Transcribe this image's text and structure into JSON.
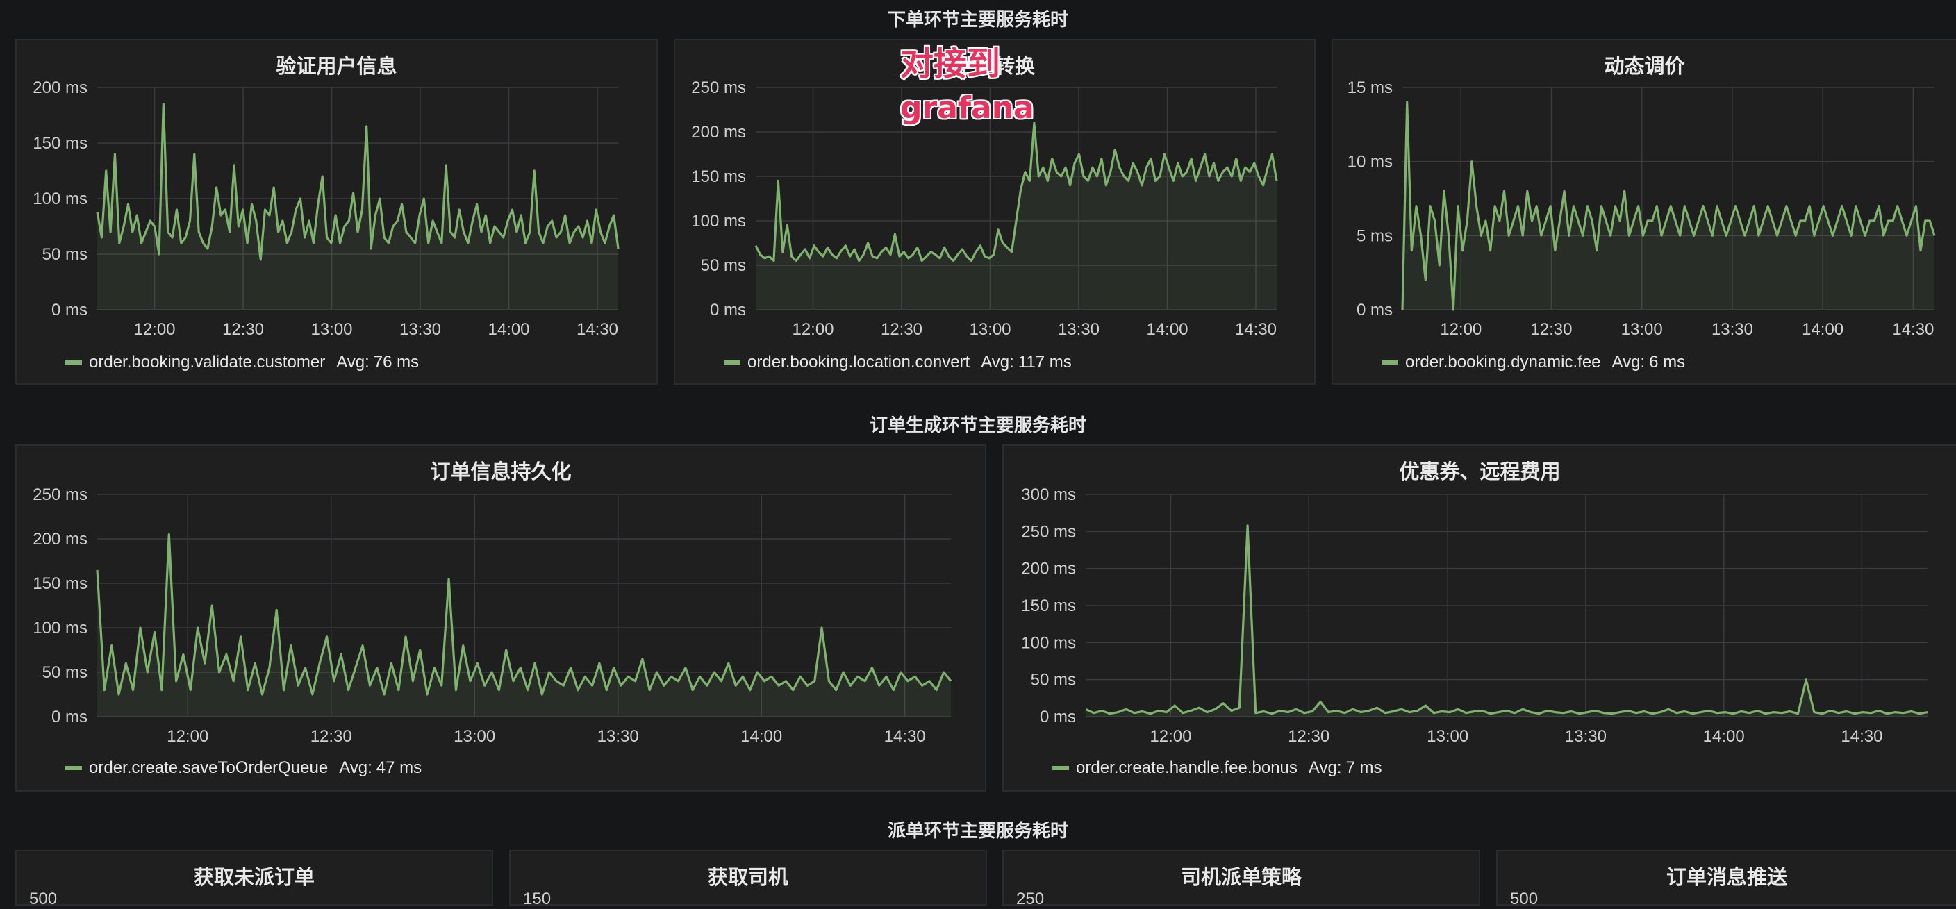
{
  "rows": [
    {
      "title": "下单环节主要服务耗时"
    },
    {
      "title": "订单生成环节主要服务耗时"
    },
    {
      "title": "派单环节主要服务耗时"
    }
  ],
  "overlay_text": {
    "line1": "对接到",
    "line2": "grafana"
  },
  "colors": {
    "series": "#7eb26d",
    "background": "#161719",
    "panel": "#1f1f20",
    "grid": "#3a3b3e"
  },
  "panels": [
    {
      "title": "验证用户信息",
      "legend": {
        "series": "order.booking.validate.customer",
        "avg_label": "Avg:",
        "avg_value": "76 ms"
      },
      "chart_data": {
        "type": "area",
        "title": "验证用户信息",
        "x_ticks": [
          "12:00",
          "12:30",
          "13:00",
          "13:30",
          "14:00",
          "14:30"
        ],
        "y_ticks": [
          "0 ms",
          "50 ms",
          "100 ms",
          "150 ms",
          "200 ms"
        ],
        "ylim": [
          0,
          200
        ],
        "unit": "ms",
        "x_range": [
          "11:39",
          "14:42"
        ],
        "series": [
          {
            "name": "order.booking.validate.customer",
            "values": [
              88,
              65,
              125,
              70,
              140,
              60,
              75,
              95,
              70,
              85,
              60,
              70,
              80,
              75,
              50,
              185,
              70,
              65,
              90,
              60,
              65,
              80,
              140,
              70,
              60,
              55,
              75,
              110,
              85,
              90,
              70,
              130,
              75,
              90,
              60,
              95,
              80,
              45,
              90,
              85,
              110,
              70,
              80,
              60,
              70,
              90,
              100,
              65,
              80,
              60,
              95,
              120,
              65,
              60,
              85,
              60,
              75,
              80,
              105,
              70,
              90,
              165,
              55,
              85,
              100,
              65,
              60,
              75,
              80,
              95,
              70,
              65,
              60,
              85,
              100,
              60,
              80,
              70,
              60,
              130,
              70,
              65,
              90,
              70,
              60,
              80,
              95,
              70,
              85,
              60,
              75,
              70,
              65,
              80,
              90,
              70,
              85,
              60,
              70,
              125,
              70,
              60,
              75,
              80,
              65,
              70,
              85,
              60,
              70,
              75,
              65,
              80,
              60,
              90,
              70,
              60,
              75,
              85,
              55
            ]
          }
        ]
      }
    },
    {
      "title": "坐标转换",
      "legend": {
        "series": "order.booking.location.convert",
        "avg_label": "Avg:",
        "avg_value": "117 ms"
      },
      "chart_data": {
        "type": "area",
        "title": "坐标转换",
        "x_ticks": [
          "12:00",
          "12:30",
          "13:00",
          "13:30",
          "14:00",
          "14:30"
        ],
        "y_ticks": [
          "0 ms",
          "50 ms",
          "100 ms",
          "150 ms",
          "200 ms",
          "250 ms"
        ],
        "ylim": [
          0,
          250
        ],
        "unit": "ms",
        "x_range": [
          "11:39",
          "14:42"
        ],
        "series": [
          {
            "name": "order.booking.location.convert",
            "values": [
              72,
              62,
              58,
              60,
              55,
              145,
              65,
              95,
              60,
              55,
              62,
              68,
              58,
              72,
              65,
              60,
              70,
              62,
              58,
              66,
              72,
              60,
              68,
              55,
              62,
              75,
              60,
              58,
              65,
              70,
              62,
              85,
              60,
              65,
              58,
              62,
              70,
              55,
              60,
              65,
              62,
              58,
              70,
              60,
              55,
              62,
              68,
              60,
              55,
              65,
              72,
              60,
              58,
              62,
              90,
              75,
              70,
              65,
              100,
              135,
              155,
              145,
              210,
              150,
              160,
              145,
              170,
              155,
              150,
              160,
              140,
              165,
              175,
              150,
              145,
              160,
              150,
              170,
              140,
              155,
              180,
              160,
              150,
              145,
              165,
              155,
              140,
              160,
              170,
              145,
              150,
              175,
              160,
              145,
              165,
              150,
              155,
              170,
              145,
              160,
              175,
              150,
              165,
              145,
              155,
              160,
              150,
              170,
              145,
              160,
              155,
              165,
              150,
              140,
              160,
              175,
              145
            ]
          }
        ]
      }
    },
    {
      "title": "动态调价",
      "legend": {
        "series": "order.booking.dynamic.fee",
        "avg_label": "Avg:",
        "avg_value": "6 ms"
      },
      "chart_data": {
        "type": "area",
        "title": "动态调价",
        "x_ticks": [
          "12:00",
          "12:30",
          "13:00",
          "13:30",
          "14:00",
          "14:30"
        ],
        "y_ticks": [
          "0 ms",
          "5 ms",
          "10 ms",
          "15 ms"
        ],
        "ylim": [
          0,
          15
        ],
        "unit": "ms",
        "x_range": [
          "11:39",
          "14:42"
        ],
        "series": [
          {
            "name": "order.booking.dynamic.fee",
            "values": [
              0,
              14,
              4,
              7,
              5,
              2,
              7,
              6,
              3,
              8,
              5,
              0,
              7,
              4,
              6,
              10,
              7,
              5,
              6,
              4,
              7,
              6,
              8,
              5,
              6,
              7,
              5,
              8,
              6,
              7,
              5,
              6,
              7,
              4,
              6,
              8,
              5,
              7,
              6,
              5,
              7,
              6,
              4,
              7,
              6,
              5,
              7,
              6,
              8,
              5,
              6,
              7,
              5,
              6,
              6,
              7,
              5,
              6,
              7,
              6,
              5,
              7,
              6,
              5,
              6,
              7,
              6,
              5,
              7,
              6,
              5,
              6,
              7,
              6,
              5,
              6,
              7,
              5,
              6,
              7,
              6,
              5,
              6,
              7,
              6,
              5,
              6,
              6,
              7,
              5,
              6,
              7,
              6,
              5,
              6,
              7,
              6,
              5,
              7,
              6,
              5,
              6,
              6,
              7,
              5,
              6,
              6,
              7,
              6,
              5,
              6,
              7,
              4,
              6,
              6,
              5
            ]
          }
        ]
      }
    },
    {
      "title": "订单信息持久化",
      "legend": {
        "series": "order.create.saveToOrderQueue",
        "avg_label": "Avg:",
        "avg_value": "47 ms"
      },
      "chart_data": {
        "type": "area",
        "title": "订单信息持久化",
        "x_ticks": [
          "12:00",
          "12:30",
          "13:00",
          "13:30",
          "14:00",
          "14:30"
        ],
        "y_ticks": [
          "0 ms",
          "50 ms",
          "100 ms",
          "150 ms",
          "200 ms",
          "250 ms"
        ],
        "ylim": [
          0,
          250
        ],
        "unit": "ms",
        "x_range": [
          "11:41",
          "14:40"
        ],
        "series": [
          {
            "name": "order.create.saveToOrderQueue",
            "values": [
              165,
              30,
              80,
              25,
              60,
              30,
              100,
              50,
              95,
              30,
              205,
              40,
              70,
              30,
              100,
              60,
              125,
              50,
              70,
              40,
              90,
              30,
              60,
              25,
              55,
              120,
              30,
              80,
              35,
              55,
              25,
              60,
              90,
              40,
              70,
              30,
              55,
              80,
              35,
              55,
              25,
              60,
              30,
              90,
              40,
              75,
              25,
              55,
              35,
              155,
              30,
              80,
              40,
              60,
              35,
              50,
              30,
              75,
              40,
              55,
              30,
              60,
              25,
              50,
              40,
              35,
              55,
              30,
              45,
              35,
              60,
              30,
              55,
              35,
              45,
              40,
              65,
              30,
              50,
              35,
              45,
              40,
              55,
              30,
              45,
              35,
              50,
              40,
              60,
              35,
              45,
              30,
              50,
              40,
              45,
              35,
              40,
              30,
              45,
              35,
              40,
              100,
              40,
              30,
              50,
              35,
              45,
              40,
              55,
              35,
              45,
              30,
              50,
              40,
              45,
              35,
              40,
              30,
              50,
              40
            ]
          }
        ]
      }
    },
    {
      "title": "优惠券、远程费用",
      "legend": {
        "series": "order.create.handle.fee.bonus",
        "avg_label": "Avg:",
        "avg_value": "7 ms"
      },
      "chart_data": {
        "type": "area",
        "title": "优惠券、远程费用",
        "x_ticks": [
          "12:00",
          "12:30",
          "13:00",
          "13:30",
          "14:00",
          "14:30"
        ],
        "y_ticks": [
          "0 ms",
          "50 ms",
          "100 ms",
          "150 ms",
          "200 ms",
          "250 ms",
          "300 ms"
        ],
        "ylim": [
          0,
          300
        ],
        "unit": "ms",
        "x_range": [
          "11:45",
          "14:45"
        ],
        "series": [
          {
            "name": "order.create.handle.fee.bonus",
            "values": [
              10,
              5,
              8,
              4,
              6,
              10,
              5,
              7,
              4,
              8,
              6,
              15,
              5,
              8,
              12,
              6,
              10,
              18,
              8,
              12,
              258,
              5,
              7,
              4,
              8,
              6,
              10,
              5,
              7,
              20,
              6,
              8,
              5,
              10,
              6,
              8,
              12,
              5,
              7,
              10,
              6,
              8,
              15,
              5,
              7,
              6,
              10,
              5,
              7,
              8,
              4,
              6,
              8,
              5,
              10,
              6,
              4,
              8,
              6,
              5,
              7,
              4,
              6,
              8,
              5,
              4,
              6,
              8,
              5,
              7,
              4,
              6,
              10,
              5,
              7,
              4,
              6,
              8,
              5,
              6,
              4,
              7,
              5,
              8,
              4,
              6,
              5,
              7,
              4,
              50,
              6,
              4,
              8,
              5,
              7,
              4,
              6,
              5,
              8,
              4,
              6,
              5,
              7,
              4,
              6
            ]
          }
        ]
      }
    },
    {
      "title": "获取未派订单",
      "y_ticks_partial": "500"
    },
    {
      "title": "获取司机",
      "y_ticks_partial": "150"
    },
    {
      "title": "司机派单策略",
      "y_ticks_partial": "250"
    },
    {
      "title": "订单消息推送",
      "y_ticks_partial": "500"
    }
  ]
}
